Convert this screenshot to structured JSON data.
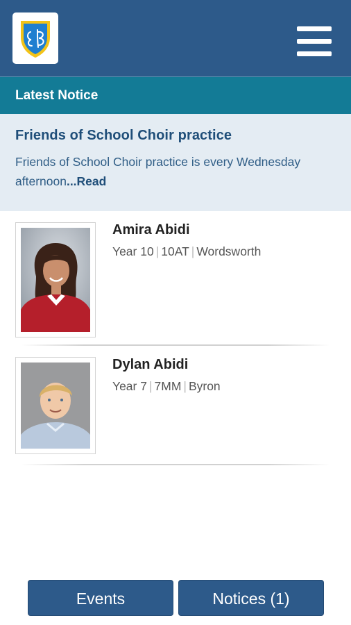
{
  "header": {
    "logo_icon": "school-crest-icon",
    "menu_icon": "hamburger-menu-icon",
    "colors": {
      "bar": "#2d5a8a",
      "crest_blue": "#1f7fd0",
      "crest_gold": "#f3c318"
    }
  },
  "notice": {
    "heading": "Latest Notice",
    "title": "Friends of School Choir practice",
    "text": "Friends of School Choir practice is every Wednesday afternoon",
    "read_link": "...Read"
  },
  "students": [
    {
      "name": "Amira Abidi",
      "year": "Year 10",
      "class": "10AT",
      "house": "Wordsworth"
    },
    {
      "name": "Dylan Abidi",
      "year": "Year 7",
      "class": "7MM",
      "house": "Byron"
    }
  ],
  "meta_separator": "|",
  "footer": {
    "events_label": "Events",
    "notices_label": "Notices (1)"
  }
}
